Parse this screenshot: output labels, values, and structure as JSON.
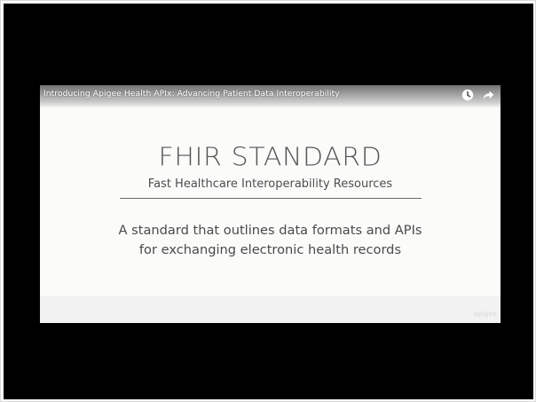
{
  "video": {
    "title": "Introducing Apigee Health APIx: Advancing Patient Data Interoperability",
    "controls": {
      "watch_later_icon": "clock-icon",
      "share_icon": "share-arrow-icon"
    }
  },
  "slide": {
    "heading": "FHIR STANDARD",
    "subheading": "Fast Healthcare Interoperability Resources",
    "body_lines": [
      "A standard that outlines data formats and APIs",
      "for exchanging electronic health records"
    ],
    "watermark": "apigee"
  },
  "colors": {
    "player_background": "#000000",
    "slide_background": "#fbfbfa",
    "heading_text": "#555555",
    "rule": "#6a6a6a"
  }
}
